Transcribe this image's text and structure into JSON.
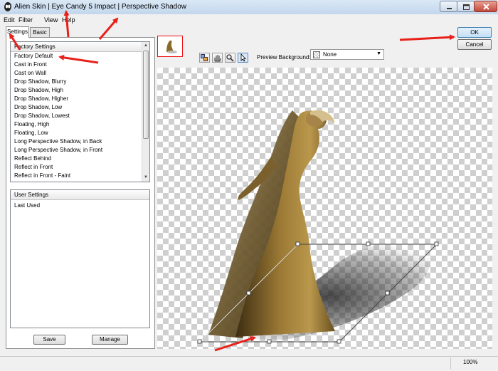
{
  "window": {
    "title": "Alien Skin | Eye Candy 5 Impact | Perspective Shadow"
  },
  "menu": [
    "Edit",
    "Filter",
    "View",
    "Help"
  ],
  "tabs": [
    {
      "label": "Settings",
      "selected": true
    },
    {
      "label": "Basic",
      "selected": false
    }
  ],
  "factory_settings": {
    "header": "Factory Settings",
    "items": [
      "Factory Default",
      "Cast in Front",
      "Cast on Wall",
      "Drop Shadow, Blurry",
      "Drop Shadow, High",
      "Drop Shadow, Higher",
      "Drop Shadow, Low",
      "Drop Shadow, Lowest",
      "Floating, High",
      "Floating, Low",
      "Long Perspective Shadow, in Back",
      "Long Perspective Shadow, in Front",
      "Reflect Behind",
      "Reflect in Front",
      "Reflect in Front - Faint"
    ]
  },
  "user_settings": {
    "header": "User Settings",
    "items": [
      "Last Used"
    ]
  },
  "buttons": {
    "save": "Save",
    "manage": "Manage",
    "ok": "OK",
    "cancel": "Cancel"
  },
  "preview_background": {
    "label": "Preview Background:",
    "value": "None"
  },
  "status": {
    "zoom": "100%"
  },
  "colors": {
    "annotation_arrow": "#e8201a",
    "shadow_handle": "#444444"
  },
  "icons": [
    "app-logo-icon",
    "minimize-icon",
    "maximize-icon",
    "close-icon",
    "preview-toggle-icon",
    "hand-icon",
    "zoom-icon",
    "arrow-pointer-icon",
    "chevron-down-icon"
  ]
}
